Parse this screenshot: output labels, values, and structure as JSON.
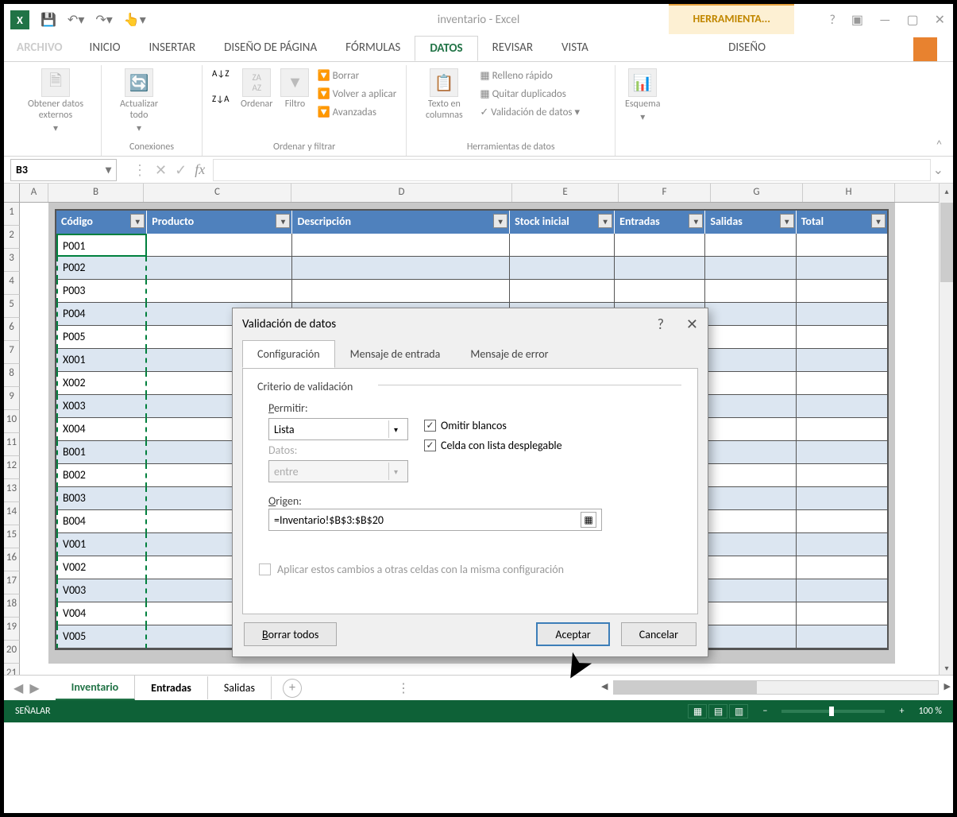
{
  "title": "inventario - Excel",
  "contextual_tab": "HERRAMIENTA...",
  "tabs": {
    "archivo": "ARCHIVO",
    "inicio": "INICIO",
    "insertar": "INSERTAR",
    "diseno_pagina": "DISEÑO DE PÁGINA",
    "formulas": "FÓRMULAS",
    "datos": "DATOS",
    "revisar": "REVISAR",
    "vista": "VISTA",
    "diseno": "DISEÑO"
  },
  "ribbon": {
    "obtener_datos": "Obtener datos externos",
    "actualizar": "Actualizar todo",
    "conexiones": "Conexiones",
    "ordenar": "Ordenar",
    "filtro": "Filtro",
    "borrar": "Borrar",
    "volver_aplicar": "Volver a aplicar",
    "avanzadas": "Avanzadas",
    "ordenar_filtrar": "Ordenar y filtrar",
    "texto_columnas": "Texto en columnas",
    "relleno": "Relleno rápido",
    "quitar_dup": "Quitar duplicados",
    "validacion": "Validación de datos",
    "herr_datos": "Herramientas de datos",
    "esquema": "Esquema"
  },
  "namebox": "B3",
  "columns": [
    "A",
    "B",
    "C",
    "D",
    "E",
    "F",
    "G",
    "H"
  ],
  "row_numbers": [
    "1",
    "2",
    "3",
    "4",
    "5",
    "6",
    "7",
    "8",
    "9",
    "10",
    "11",
    "12",
    "13",
    "14",
    "15",
    "16",
    "17",
    "18",
    "19",
    "20",
    "21"
  ],
  "headers": {
    "codigo": "Código",
    "producto": "Producto",
    "descripcion": "Descripción",
    "stock_inicial": "Stock inicial",
    "entradas": "Entradas",
    "salidas": "Salidas",
    "total": "Total"
  },
  "codes": [
    "P001",
    "P002",
    "P003",
    "P004",
    "P005",
    "X001",
    "X002",
    "X003",
    "X004",
    "B001",
    "B002",
    "B003",
    "B004",
    "V001",
    "V002",
    "V003",
    "V004",
    "V005"
  ],
  "dialog": {
    "title": "Validación de datos",
    "tab_config": "Configuración",
    "tab_msg_entrada": "Mensaje de entrada",
    "tab_msg_error": "Mensaje de error",
    "criterio": "Criterio de validación",
    "permitir": "Permitir:",
    "permitir_val": "Lista",
    "datos": "Datos:",
    "datos_val": "entre",
    "omitir_blancos": "Omitir blancos",
    "celda_lista": "Celda con lista desplegable",
    "origen": "Origen:",
    "origen_val": "=Inventario!$B$3:$B$20",
    "aplicar": "Aplicar estos cambios a otras celdas con la misma configuración",
    "borrar_todos": "Borrar todos",
    "aceptar": "Aceptar",
    "cancelar": "Cancelar"
  },
  "sheets": {
    "inventario": "Inventario",
    "entradas": "Entradas",
    "salidas": "Salidas"
  },
  "status": {
    "mode": "SEÑALAR",
    "zoom": "100 %"
  }
}
